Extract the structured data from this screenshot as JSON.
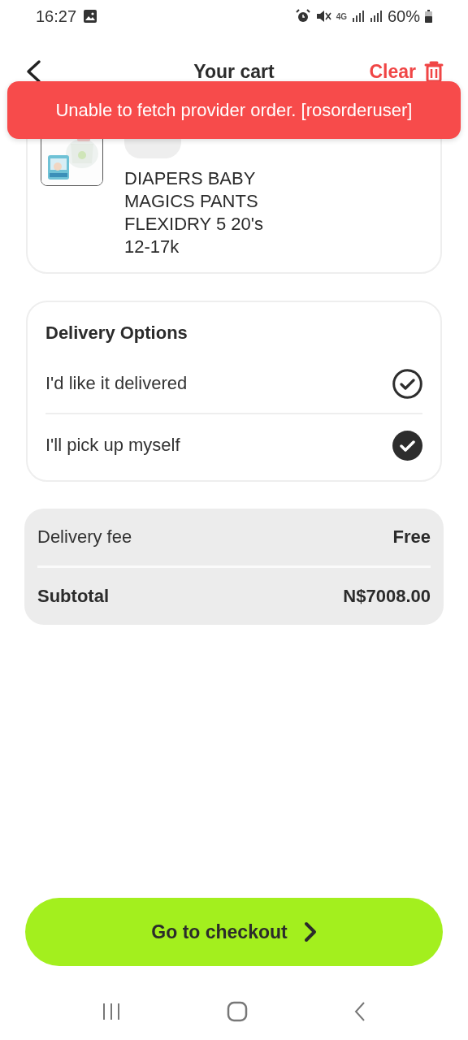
{
  "status_bar": {
    "time": "16:27",
    "network": "4G",
    "battery": "60%"
  },
  "header": {
    "title": "Your cart",
    "clear": "Clear"
  },
  "toast": {
    "message": "Unable to fetch provider order. [rosorderuser]"
  },
  "cart_items": [
    {
      "name": "DIAPERS BABY MAGICS PANTS FLEXIDRY 5 20's 12-17k"
    }
  ],
  "delivery_options": {
    "title": "Delivery Options",
    "options": [
      {
        "label": "I'd like it delivered",
        "selected": false
      },
      {
        "label": "I'll pick up myself",
        "selected": true
      }
    ]
  },
  "summary": [
    {
      "label": "Delivery fee",
      "value": "Free",
      "kind": "plain"
    },
    {
      "label": "Subtotal",
      "value": "N$7008.00",
      "kind": "bold"
    }
  ],
  "checkout": {
    "label": "Go to checkout"
  }
}
